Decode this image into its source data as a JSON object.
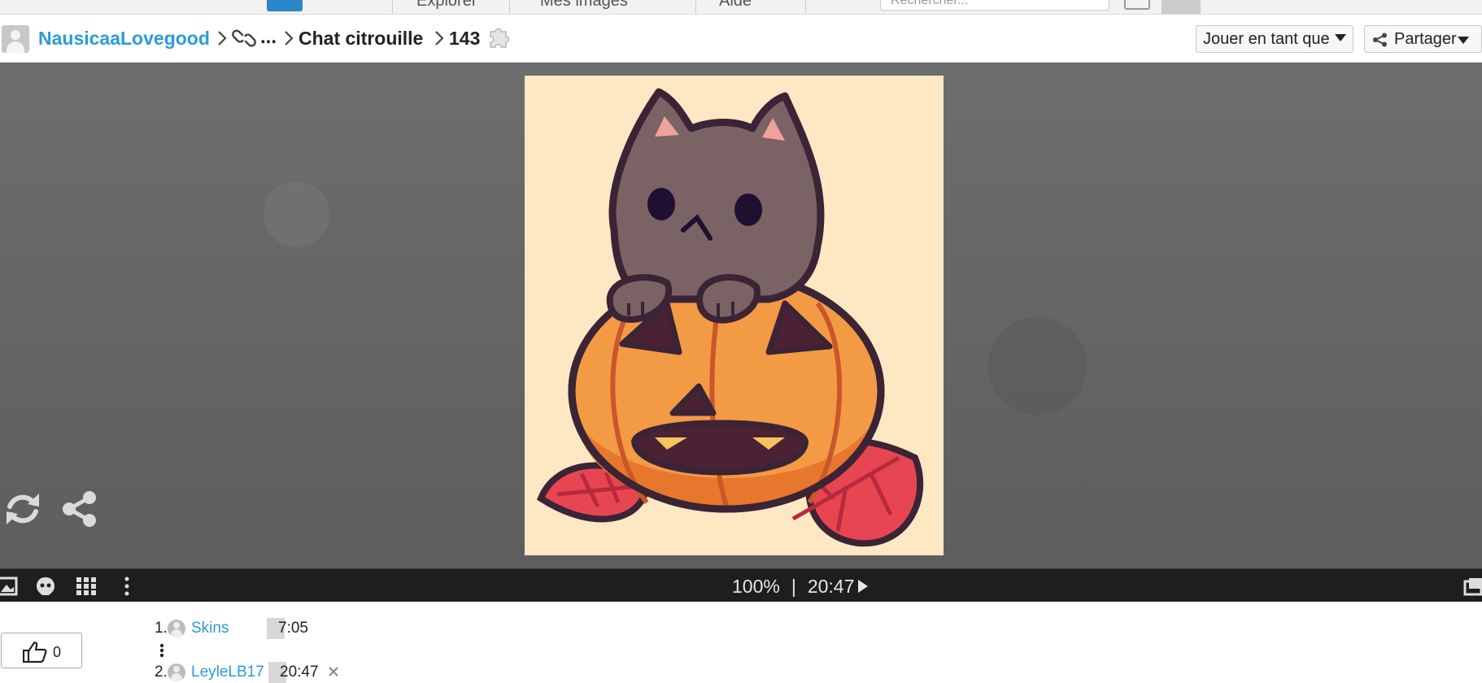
{
  "topbar": {
    "nav_items": [
      "Explorer",
      "Mes images",
      "Aide"
    ],
    "search_placeholder": "Rechercher..."
  },
  "breadcrumb": {
    "user": "NausicaaLovegood",
    "ellipsis": "...",
    "title": "Chat citrouille",
    "piece_count": "143"
  },
  "actions": {
    "play_as_label": "Jouer en tant que",
    "share_label": "Partager"
  },
  "toolbar": {
    "zoom": "100%",
    "separator": "|",
    "timer": "20:47"
  },
  "like": {
    "count": "0"
  },
  "scores": [
    {
      "rank": "1.",
      "name": "Skins",
      "time": "7:05"
    },
    {
      "rank": "2.",
      "name": "LeyleLB17",
      "time": "20:47"
    }
  ],
  "image": {
    "background": "#fde8c3",
    "subject": "cat-on-jack-o-lantern"
  },
  "colors": {
    "link": "#2b9cd8",
    "toolbar_bg": "#1e1e1e",
    "stage_bg": "#6a6a6a"
  }
}
